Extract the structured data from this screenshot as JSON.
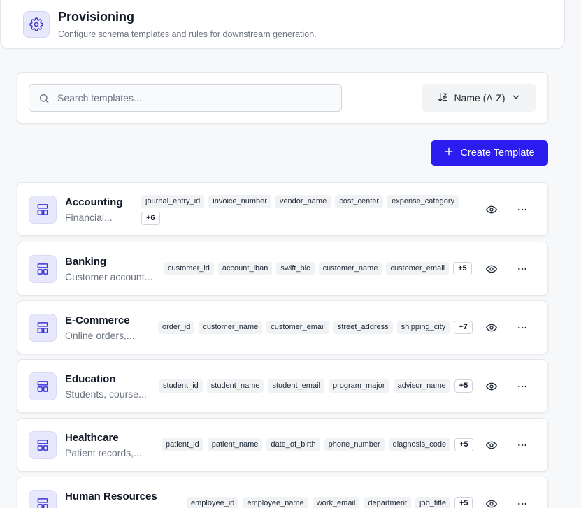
{
  "header": {
    "title": "Provisioning",
    "subtitle": "Configure schema templates and rules for downstream generation.",
    "icon": "gear-icon"
  },
  "search": {
    "placeholder": "Search templates...",
    "value": ""
  },
  "sort": {
    "label": "Name (A-Z)",
    "icon": "sort-icon"
  },
  "create_button": {
    "label": "Create Template"
  },
  "colors": {
    "accent": "#2b1cf0",
    "icon_bg": "#e8e8fc",
    "icon_fg": "#3b35d9"
  },
  "templates": [
    {
      "name": "Accounting",
      "description": "Financial...",
      "tags": [
        "journal_entry_id",
        "invoice_number",
        "vendor_name",
        "cost_center",
        "expense_category"
      ],
      "more": "+6"
    },
    {
      "name": "Banking",
      "description": "Customer account...",
      "tags": [
        "customer_id",
        "account_iban",
        "swift_bic",
        "customer_name",
        "customer_email"
      ],
      "more": "+5"
    },
    {
      "name": "E-Commerce",
      "description": "Online orders,...",
      "tags": [
        "order_id",
        "customer_name",
        "customer_email",
        "street_address",
        "shipping_city"
      ],
      "more": "+7"
    },
    {
      "name": "Education",
      "description": "Students, course...",
      "tags": [
        "student_id",
        "student_name",
        "student_email",
        "program_major",
        "advisor_name"
      ],
      "more": "+5"
    },
    {
      "name": "Healthcare",
      "description": "Patient records,...",
      "tags": [
        "patient_id",
        "patient_name",
        "date_of_birth",
        "phone_number",
        "diagnosis_code"
      ],
      "more": "+5"
    },
    {
      "name": "Human Resources",
      "description": "",
      "tags": [
        "employee_id",
        "employee_name",
        "work_email",
        "department",
        "job_title"
      ],
      "more": "+5"
    }
  ]
}
